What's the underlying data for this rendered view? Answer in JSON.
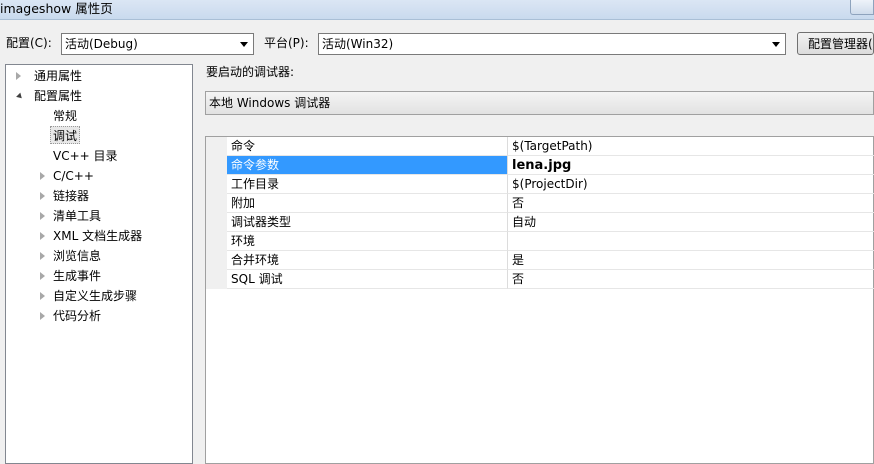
{
  "window": {
    "title": "imageshow 属性页"
  },
  "toolbar": {
    "config_label": "配置(C):",
    "config_value": "活动(Debug)",
    "platform_label": "平台(P):",
    "platform_value": "活动(Win32)",
    "config_manager_label": "配置管理器(O)..."
  },
  "tree": {
    "items": [
      {
        "label": "通用属性",
        "expander": "collapsed"
      },
      {
        "label": "配置属性",
        "expander": "expanded"
      },
      {
        "label": "常规",
        "expander": "none"
      },
      {
        "label": "调试",
        "expander": "none",
        "selected": true
      },
      {
        "label": "VC++ 目录",
        "expander": "none"
      },
      {
        "label": "C/C++",
        "expander": "collapsed"
      },
      {
        "label": "链接器",
        "expander": "collapsed"
      },
      {
        "label": "清单工具",
        "expander": "collapsed"
      },
      {
        "label": "XML 文档生成器",
        "expander": "collapsed"
      },
      {
        "label": "浏览信息",
        "expander": "collapsed"
      },
      {
        "label": "生成事件",
        "expander": "collapsed"
      },
      {
        "label": "自定义生成步骤",
        "expander": "collapsed"
      },
      {
        "label": "代码分析",
        "expander": "collapsed"
      }
    ]
  },
  "debugger": {
    "label": "要启动的调试器:",
    "value": "本地 Windows 调试器"
  },
  "properties": [
    {
      "name": "命令",
      "value": "$(TargetPath)"
    },
    {
      "name": "命令参数",
      "value": "lena.jpg",
      "selected": true
    },
    {
      "name": "工作目录",
      "value": "$(ProjectDir)"
    },
    {
      "name": "附加",
      "value": "否"
    },
    {
      "name": "调试器类型",
      "value": "自动"
    },
    {
      "name": "环境",
      "value": ""
    },
    {
      "name": "合并环境",
      "value": "是"
    },
    {
      "name": "SQL 调试",
      "value": "否"
    }
  ],
  "colors": {
    "selection": "#3399ff",
    "titlebar": "#dbe6f4"
  }
}
